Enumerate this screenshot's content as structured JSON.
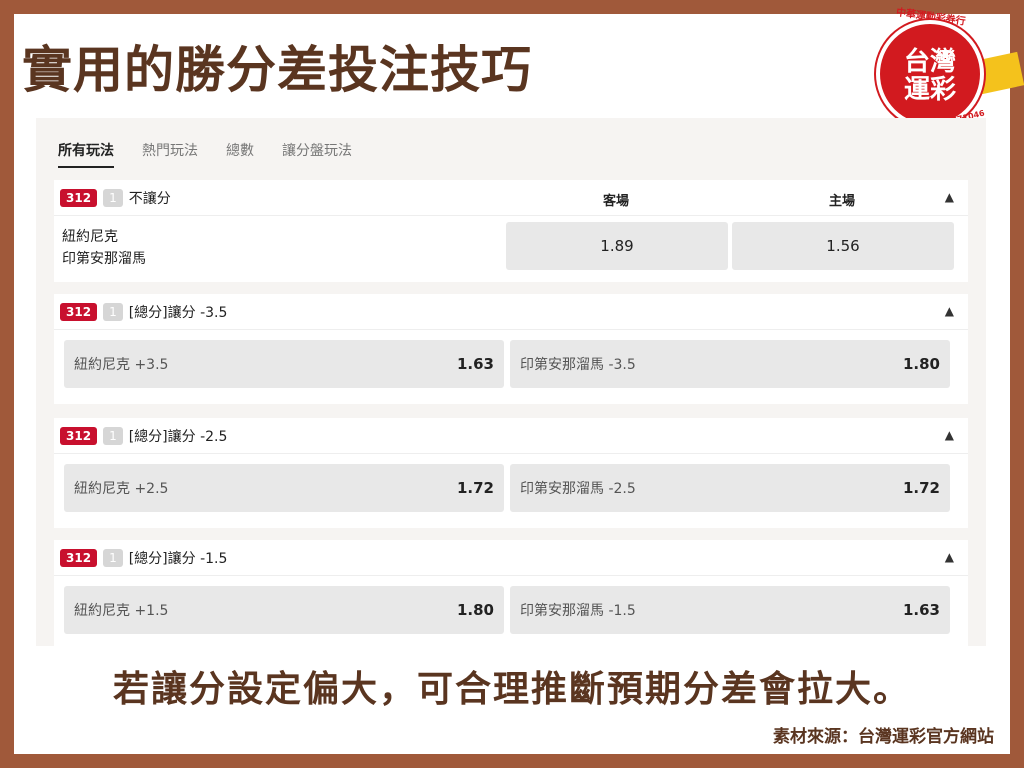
{
  "title": "實用的勝分差投注技巧",
  "logo": {
    "line1": "台灣",
    "line2": "運彩",
    "arc_top": "中華運動彩券行",
    "arc_bottom": "經銷商證號:93271046",
    "colors": {
      "red": "#d21a1f",
      "yellow": "#f4c21c"
    }
  },
  "tabs": [
    "所有玩法",
    "熱門玩法",
    "總數",
    "讓分盤玩法"
  ],
  "active_tab": "所有玩法",
  "markets": [
    {
      "code": "312",
      "num": "1",
      "label": "不讓分",
      "away_header": "客場",
      "home_header": "主場",
      "team1": "紐約尼克",
      "team2": "印第安那溜馬",
      "away_odds": "1.89",
      "home_odds": "1.56"
    },
    {
      "code": "312",
      "num": "1",
      "label": "[總分]讓分 -3.5",
      "left_pick": "紐約尼克 +3.5",
      "left_odds": "1.63",
      "right_pick": "印第安那溜馬 -3.5",
      "right_odds": "1.80"
    },
    {
      "code": "312",
      "num": "1",
      "label": "[總分]讓分 -2.5",
      "left_pick": "紐約尼克 +2.5",
      "left_odds": "1.72",
      "right_pick": "印第安那溜馬 -2.5",
      "right_odds": "1.72"
    },
    {
      "code": "312",
      "num": "1",
      "label": "[總分]讓分 -1.5",
      "left_pick": "紐約尼克 +1.5",
      "left_odds": "1.80",
      "right_pick": "印第安那溜馬 -1.5",
      "right_odds": "1.63"
    }
  ],
  "caption": "若讓分設定偏大，可合理推斷預期分差會拉大。",
  "source": "素材來源：台灣運彩官方網站",
  "colors": {
    "frame": "#a0593a",
    "text_brown": "#5a3520",
    "badge_red": "#c8102e"
  }
}
